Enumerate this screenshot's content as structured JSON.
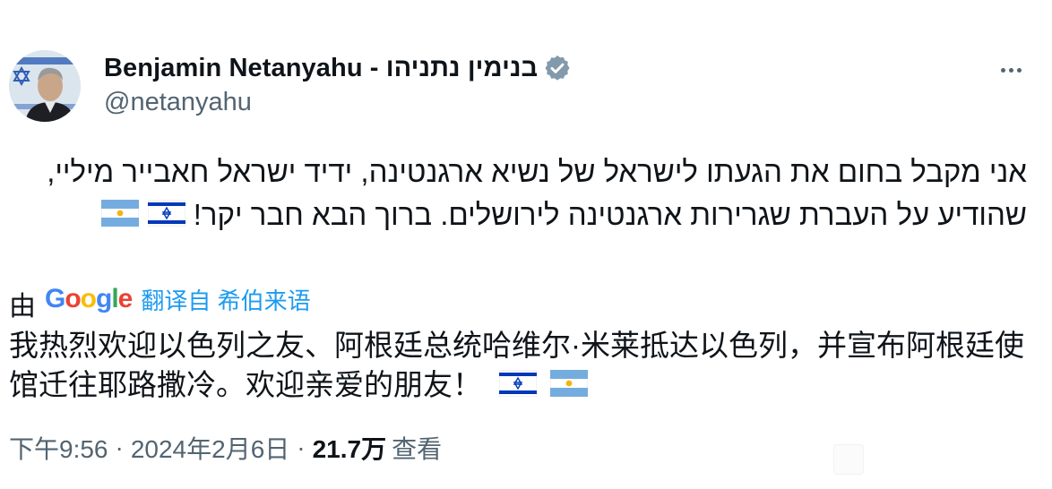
{
  "author": {
    "display_name": "Benjamin Netanyahu - בנימין נתניהו",
    "handle": "@netanyahu",
    "verified_badge_color": "#829aab"
  },
  "post": {
    "hebrew_text": "אני מקבל בחום את הגעתו לישראל של נשיא ארגנטינה, ידיד ישראל חאבייר מיליי, שהודיע על העברת שגרירות ארגנטינה לירושלים. ברוך הבא חבר יקר!",
    "translation_by_label": "由",
    "translation_provider": "Google",
    "translation_link": "翻译自 希伯来语",
    "translated_text": "我热烈欢迎以色列之友、阿根廷总统哈维尔·米莱抵达以色列，并宣布阿根廷使馆迁往耶路撒冷。欢迎亲爱的朋友！"
  },
  "meta": {
    "time": "下午9:56",
    "separator": "·",
    "date": "2024年2月6日",
    "views_count": "21.7万",
    "views_label": "查看"
  },
  "icons": [
    "verified-badge-icon",
    "more-options-icon",
    "israel-flag-icon",
    "argentina-flag-icon"
  ],
  "colors": {
    "text": "#0f1419",
    "secondary": "#536471",
    "link": "#1d9bf0",
    "google_blue": "#4285f4",
    "google_red": "#ea4335",
    "google_yellow": "#fbbc05",
    "google_green": "#34a853",
    "israel_blue": "#0038b8",
    "argentina_blue": "#74acdf",
    "argentina_sun": "#f6b40e"
  }
}
